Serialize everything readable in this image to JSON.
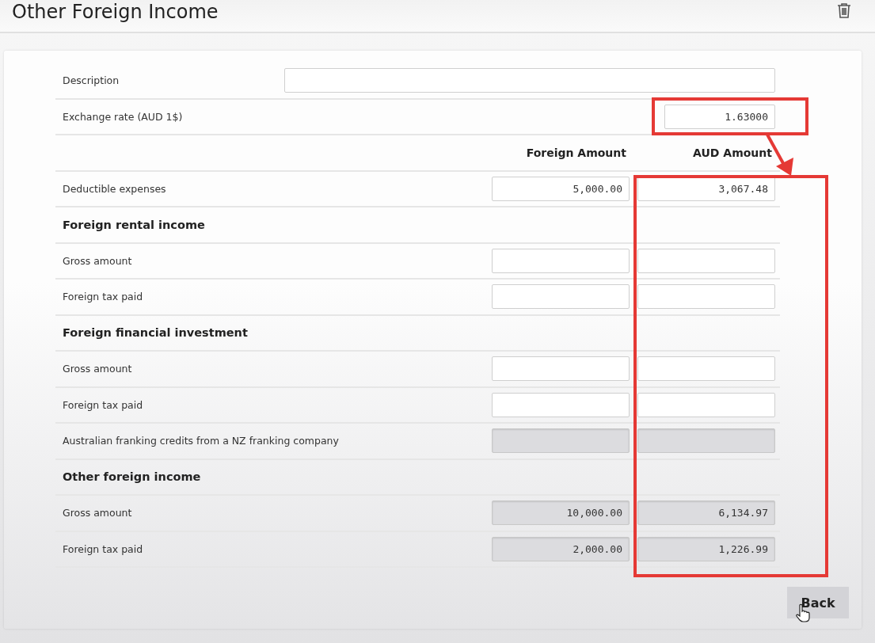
{
  "header": {
    "title": "Other Foreign Income"
  },
  "description": {
    "label": "Description"
  },
  "exchange_rate": {
    "label": "Exchange rate (AUD 1$)",
    "value": "1.63000"
  },
  "columns": [
    "Foreign Amount",
    "AUD Amount"
  ],
  "rows": [
    {
      "kind": "field",
      "label": "Deductible expenses",
      "foreign": "5,000.00",
      "aud": "3,067.48",
      "disabled": false
    },
    {
      "kind": "section",
      "label": "Foreign rental income"
    },
    {
      "kind": "field",
      "label": "Gross amount",
      "disabled": false
    },
    {
      "kind": "field",
      "label": "Foreign tax paid",
      "disabled": false
    },
    {
      "kind": "section",
      "label": "Foreign financial investment"
    },
    {
      "kind": "field",
      "label": "Gross amount",
      "disabled": false
    },
    {
      "kind": "field",
      "label": "Foreign tax paid",
      "disabled": false
    },
    {
      "kind": "field",
      "label": "Australian franking credits from a NZ franking company",
      "disabled": true
    },
    {
      "kind": "section",
      "label": "Other foreign income"
    },
    {
      "kind": "field",
      "label": "Gross amount",
      "foreign": "10,000.00",
      "aud": "6,134.97",
      "disabled": true
    },
    {
      "kind": "field",
      "label": "Foreign tax paid",
      "foreign": "2,000.00",
      "aud": "1,226.99",
      "disabled": true
    }
  ],
  "back_button": {
    "label": "Back"
  }
}
